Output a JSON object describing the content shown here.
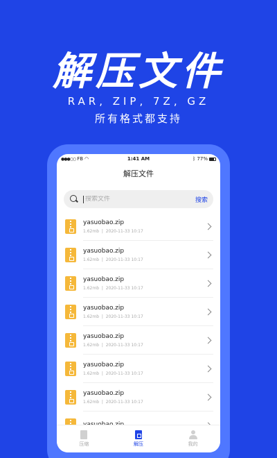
{
  "hero": {
    "title": "解压文件",
    "formats": "RAR, ZIP, 7Z, GZ",
    "subtitle": "所有格式都支持"
  },
  "status_bar": {
    "carrier": "FB",
    "time": "1:41 AM",
    "battery": "77%"
  },
  "app": {
    "title": "解压文件"
  },
  "search": {
    "placeholder": "搜索文件",
    "button_label": "搜索"
  },
  "files": [
    {
      "name": "yasuobao.zip",
      "size": "1.62mb",
      "date": "2020-11-33 10:17"
    },
    {
      "name": "yasuobao.zip",
      "size": "1.62mb",
      "date": "2020-11-33 10:17"
    },
    {
      "name": "yasuobao.zip",
      "size": "1.62mb",
      "date": "2020-11-33 10:17"
    },
    {
      "name": "yasuobao.zip",
      "size": "1.62mb",
      "date": "2020-11-33 10:17"
    },
    {
      "name": "yasuobao.zip",
      "size": "1.62mb",
      "date": "2020-11-33 10:17"
    },
    {
      "name": "yasuobao.zip",
      "size": "1.62mb",
      "date": "2020-11-33 10:17"
    },
    {
      "name": "yasuobao.zip",
      "size": "1.62mb",
      "date": "2020-11-33 10:17"
    },
    {
      "name": "yasuobao.zip",
      "size": "",
      "date": ""
    }
  ],
  "meta_separator": "|",
  "tabs": [
    {
      "label": "压缩",
      "icon": "compress-icon",
      "active": false
    },
    {
      "label": "解压",
      "icon": "extract-icon",
      "active": true
    },
    {
      "label": "我的",
      "icon": "user-icon",
      "active": false
    }
  ],
  "colors": {
    "accent": "#1f44e6",
    "zip_icon": "#f5b83a"
  }
}
